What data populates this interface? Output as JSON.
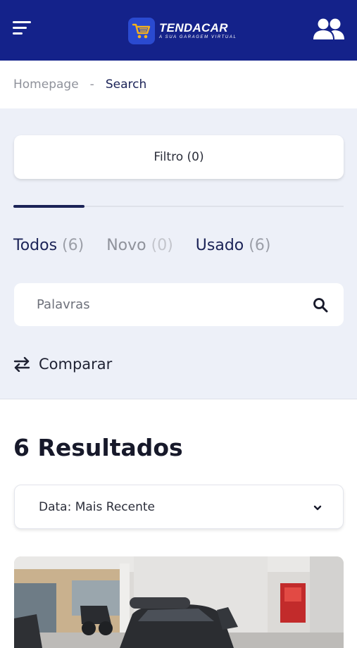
{
  "header": {
    "logo_name": "TENDACAR",
    "logo_tagline": "A SUA GARAGEM VIRTUAL",
    "menu_icon": "menu-icon",
    "users_icon": "users-icon",
    "brand_color": "#14228a"
  },
  "breadcrumb": {
    "home": "Homepage",
    "separator": "-",
    "current": "Search"
  },
  "filter": {
    "button_label": "Filtro (0)"
  },
  "tabs": [
    {
      "label": "Todos",
      "count": "(6)",
      "active": true
    },
    {
      "label": "Novo",
      "count": "(0)",
      "active": false
    },
    {
      "label": "Usado",
      "count": "(6)",
      "active": false
    }
  ],
  "search": {
    "placeholder": "Palavras",
    "value": "",
    "icon": "search-icon"
  },
  "compare": {
    "label": "Comparar",
    "icon": "compare-arrows-icon"
  },
  "results": {
    "title": "6 Resultados"
  },
  "sort": {
    "selected": "Data: Mais Recente",
    "icon": "chevron-down-icon"
  },
  "listing": {
    "image": "car-photo"
  }
}
